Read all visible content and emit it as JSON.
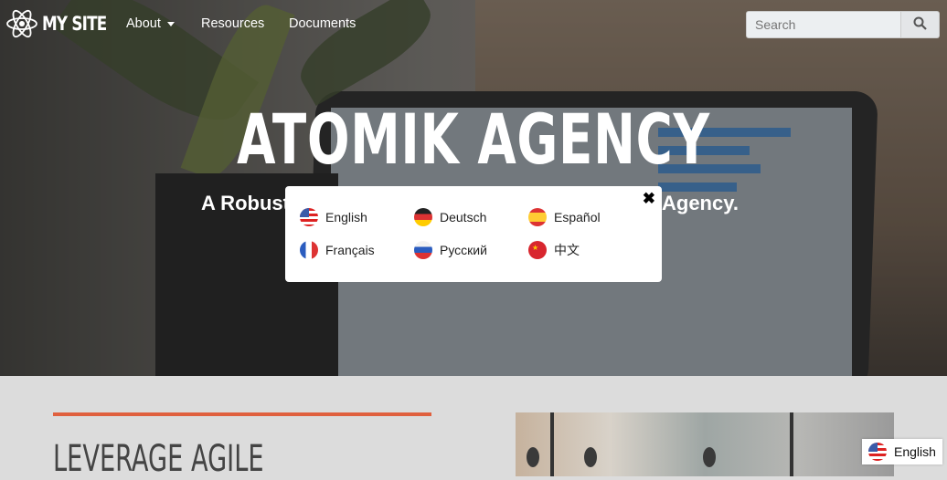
{
  "nav": {
    "brand": "MY SITE",
    "links": [
      {
        "label": "About",
        "has_dropdown": true
      },
      {
        "label": "Resources"
      },
      {
        "label": "Documents"
      }
    ],
    "search": {
      "placeholder": "Search",
      "icon": "search-icon"
    }
  },
  "hero": {
    "title": "ATOMIK AGENCY",
    "subtitle_left_visible": "A Robust",
    "subtitle_right_visible": "Agency."
  },
  "language_modal": {
    "close_icon": "close-icon",
    "languages": [
      {
        "label": "English",
        "flag": "us"
      },
      {
        "label": "Deutsch",
        "flag": "de"
      },
      {
        "label": "Español",
        "flag": "es"
      },
      {
        "label": "Français",
        "flag": "fr"
      },
      {
        "label": "Русский",
        "flag": "ru"
      },
      {
        "label": "中文",
        "flag": "cn"
      }
    ]
  },
  "section": {
    "heading": "LEVERAGE AGILE",
    "accent_color": "#e0603e"
  },
  "language_button": {
    "label": "English",
    "flag": "us"
  }
}
